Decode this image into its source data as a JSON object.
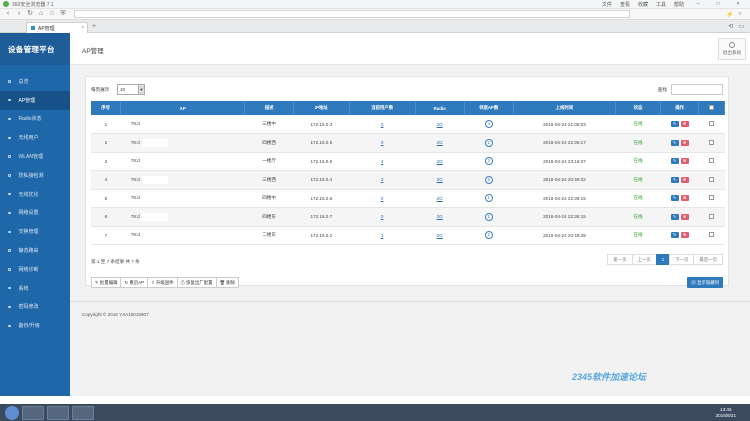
{
  "browser": {
    "title": "360安全浏览器 7.1",
    "menus": [
      "文件",
      "查看",
      "收藏",
      "工具",
      "帮助"
    ],
    "tab_title": "AP管理"
  },
  "app": {
    "brand": "设备管理平台",
    "page_title": "AP管理",
    "logout_label": "退出系统"
  },
  "sidebar": {
    "items": [
      {
        "label": "总览"
      },
      {
        "label": "AP管理"
      },
      {
        "label": "Radio状态"
      },
      {
        "label": "无线用户"
      },
      {
        "label": "WLAN管理"
      },
      {
        "label": "防私接检测"
      },
      {
        "label": "无线优化"
      },
      {
        "label": "网络设置"
      },
      {
        "label": "交换管理"
      },
      {
        "label": "静态路由"
      },
      {
        "label": "网络诊断"
      },
      {
        "label": "系统"
      },
      {
        "label": "密码修改"
      },
      {
        "label": "备份/升级"
      }
    ]
  },
  "toolbar": {
    "per_page_label": "每页展示",
    "per_page_value": "10",
    "search_label": "查找"
  },
  "table": {
    "headers": [
      "序号",
      "AP",
      "描述",
      "IP地址",
      "当前用户数",
      "Radio",
      "邻居AP数",
      "上线时间",
      "状态",
      "操作"
    ],
    "rows": [
      {
        "no": "1",
        "ap": "78:d",
        "desc": "三楼中",
        "ip": "172.16.0.3",
        "users": "2",
        "radio": "2G",
        "neighbors": "4",
        "online": "2016-04-24 21:05:03",
        "status": "在线"
      },
      {
        "no": "2",
        "ap": "78:d",
        "desc": "四楼西",
        "ip": "172.16.0.5",
        "users": "0",
        "radio": "2G",
        "neighbors": "1",
        "online": "2016-04-24 22:36:17",
        "status": "在线"
      },
      {
        "no": "3",
        "ap": "78:d",
        "desc": "一楼厅",
        "ip": "172.16.0.6",
        "users": "4",
        "radio": "2G",
        "neighbors": "3",
        "online": "2016-04-24 23:16:37",
        "status": "在线"
      },
      {
        "no": "4",
        "ap": "78:d",
        "desc": "三楼西",
        "ip": "172.16.0.4",
        "users": "3",
        "radio": "2G",
        "neighbors": "2",
        "online": "2016-04-24 20:49:32",
        "status": "在线"
      },
      {
        "no": "5",
        "ap": "78:d",
        "desc": "四楼中",
        "ip": "172.16.0.6",
        "users": "0",
        "radio": "2G",
        "neighbors": "1",
        "online": "2016-04-24 22:36:15",
        "status": "在线"
      },
      {
        "no": "6",
        "ap": "78:d",
        "desc": "四楼东",
        "ip": "172.16.0.7",
        "users": "0",
        "radio": "2G",
        "neighbors": "1",
        "online": "2016-04-24 22:36:15",
        "status": "在线"
      },
      {
        "no": "7",
        "ap": "78:d",
        "desc": "二楼东",
        "ip": "172.16.0.2",
        "users": "1",
        "radio": "2G",
        "neighbors": "2",
        "online": "2016-04-24 20:49:28",
        "status": "在线"
      }
    ]
  },
  "summary": "第 1 至 7 条结果   共 7 条",
  "pager": {
    "first": "第一页",
    "prev": "上一页",
    "current": "1",
    "next": "下一页",
    "last": "最后一页"
  },
  "actions": {
    "batch_edit": "批量编辑",
    "restart": "重启AP",
    "upgrade": "升级固件",
    "factory_reset": "恢复出厂配置",
    "delete": "删除",
    "show_hidden": "显示隐藏列"
  },
  "footer": {
    "copyright": "Copyright © 2016 YXA10015907"
  },
  "watermark": "2345软件加速论坛",
  "taskbar": {
    "time": "13:45",
    "date": "2016/9/21"
  },
  "colors": {
    "sidebar": "#1e67a8",
    "header_row": "#2f79bd",
    "online_status": "#2e9e2e"
  }
}
